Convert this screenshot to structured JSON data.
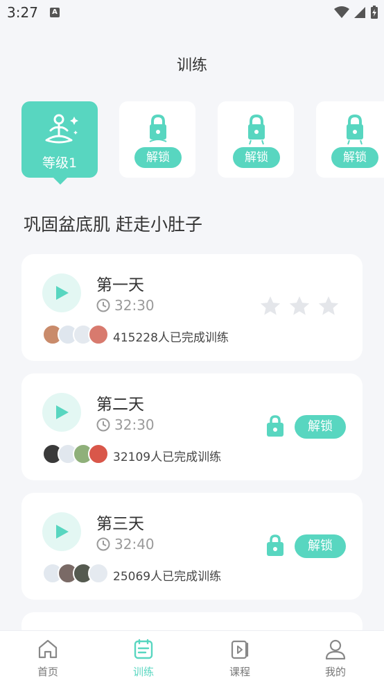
{
  "status_bar": {
    "time": "3:27",
    "a_badge": "A"
  },
  "header": {
    "title": "训练"
  },
  "levels": [
    {
      "label": "等级1",
      "state": "active"
    },
    {
      "label": "解锁",
      "state": "locked"
    },
    {
      "label": "解锁",
      "state": "locked"
    },
    {
      "label": "解锁",
      "state": "locked"
    }
  ],
  "section": {
    "title": "巩固盆底肌 赶走小肚子"
  },
  "days": [
    {
      "title": "第一天",
      "duration": "32:30",
      "completed": "415228人已完成训练",
      "rating_stars": 3,
      "locked": false
    },
    {
      "title": "第二天",
      "duration": "32:30",
      "completed": "32109人已完成训练",
      "locked": true,
      "unlock_label": "解锁"
    },
    {
      "title": "第三天",
      "duration": "32:40",
      "completed": "25069人已完成训练",
      "locked": true,
      "unlock_label": "解锁"
    }
  ],
  "tabbar": {
    "items": [
      {
        "label": "首页",
        "icon": "home-icon",
        "active": false
      },
      {
        "label": "训练",
        "icon": "training-icon",
        "active": true
      },
      {
        "label": "课程",
        "icon": "course-icon",
        "active": false
      },
      {
        "label": "我的",
        "icon": "profile-icon",
        "active": false
      }
    ]
  },
  "colors": {
    "accent": "#58d6c0",
    "accent_light": "#e3f7f3",
    "background": "#f5f6f9"
  }
}
